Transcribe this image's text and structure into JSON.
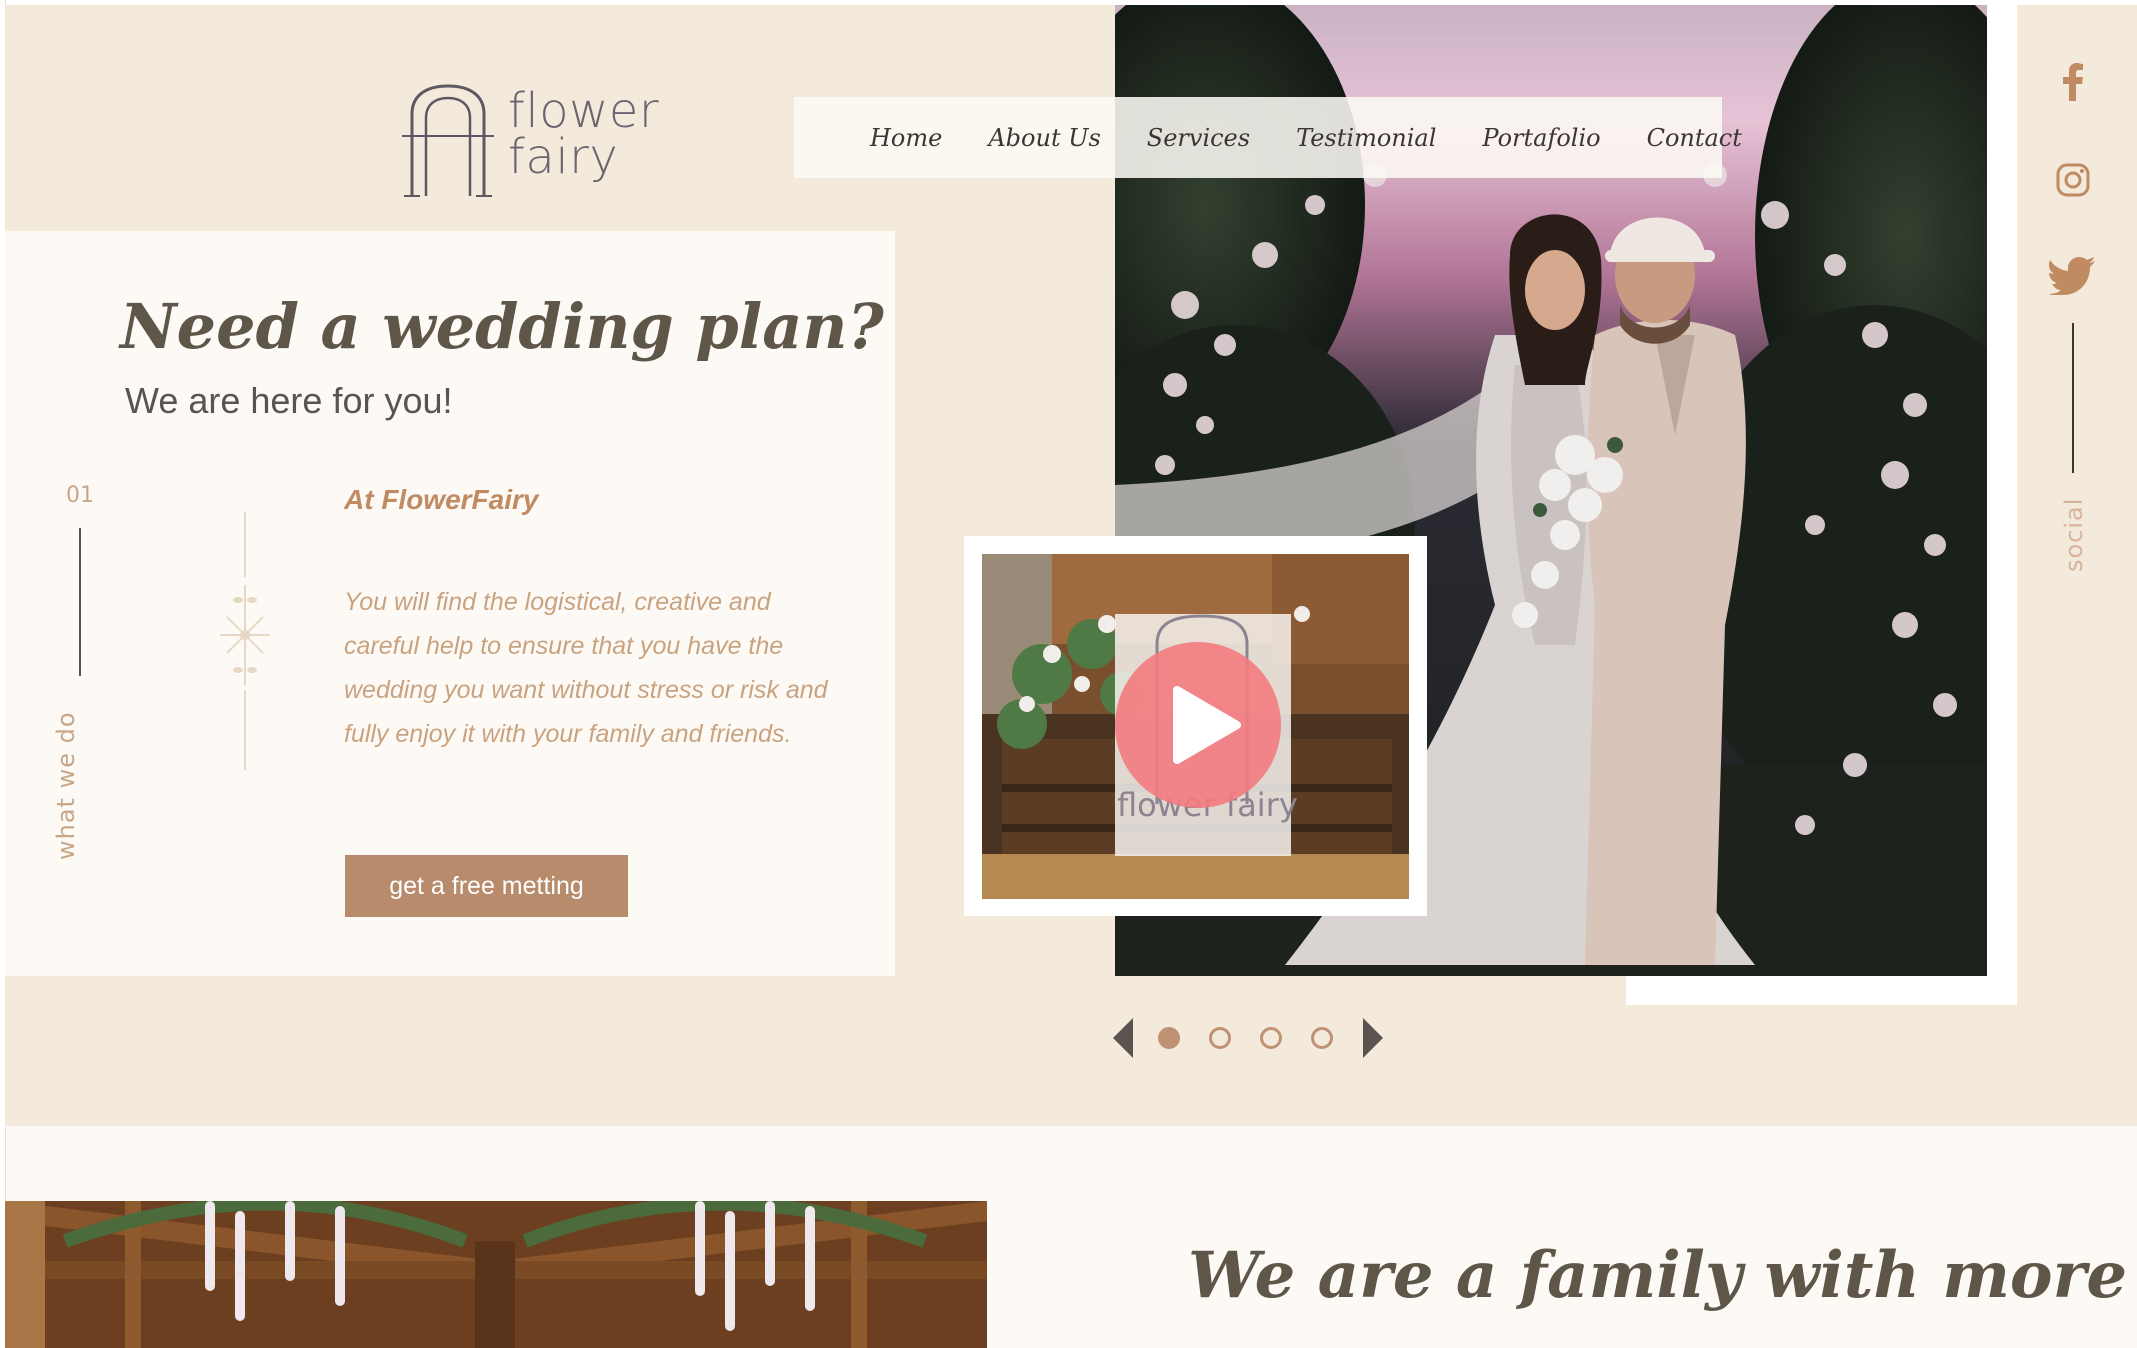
{
  "brand": {
    "logo_line1": "flower",
    "logo_line2": "fairy"
  },
  "nav": {
    "items": [
      "Home",
      "About Us",
      "Services",
      "Testimonial",
      "Portafolio",
      "Contact"
    ]
  },
  "hero": {
    "headline": "Need a wedding plan?",
    "subline": "We are here for you!",
    "section_number": "01",
    "section_label": "what we do",
    "title": "At FlowerFairy",
    "paragraph": "You will find the logistical, creative and careful help to ensure that you have the wedding you want without stress or risk and fully enjoy it with your family and friends.",
    "cta_label": "get a free metting"
  },
  "video": {
    "watermark": "flower fairy"
  },
  "carousel": {
    "dot_count": 4,
    "active_index": 0
  },
  "social": {
    "label": "social",
    "icons": [
      "facebook-icon",
      "instagram-icon",
      "twitter-icon"
    ]
  },
  "section2": {
    "heading": "We are a family with more"
  },
  "colors": {
    "hero_bg": "#f4eadc",
    "card_bg": "#fdfaf6",
    "accent": "#b78b6b",
    "accent_text": "#c08a62",
    "heading": "#5e5648",
    "play": "#f27b80"
  }
}
